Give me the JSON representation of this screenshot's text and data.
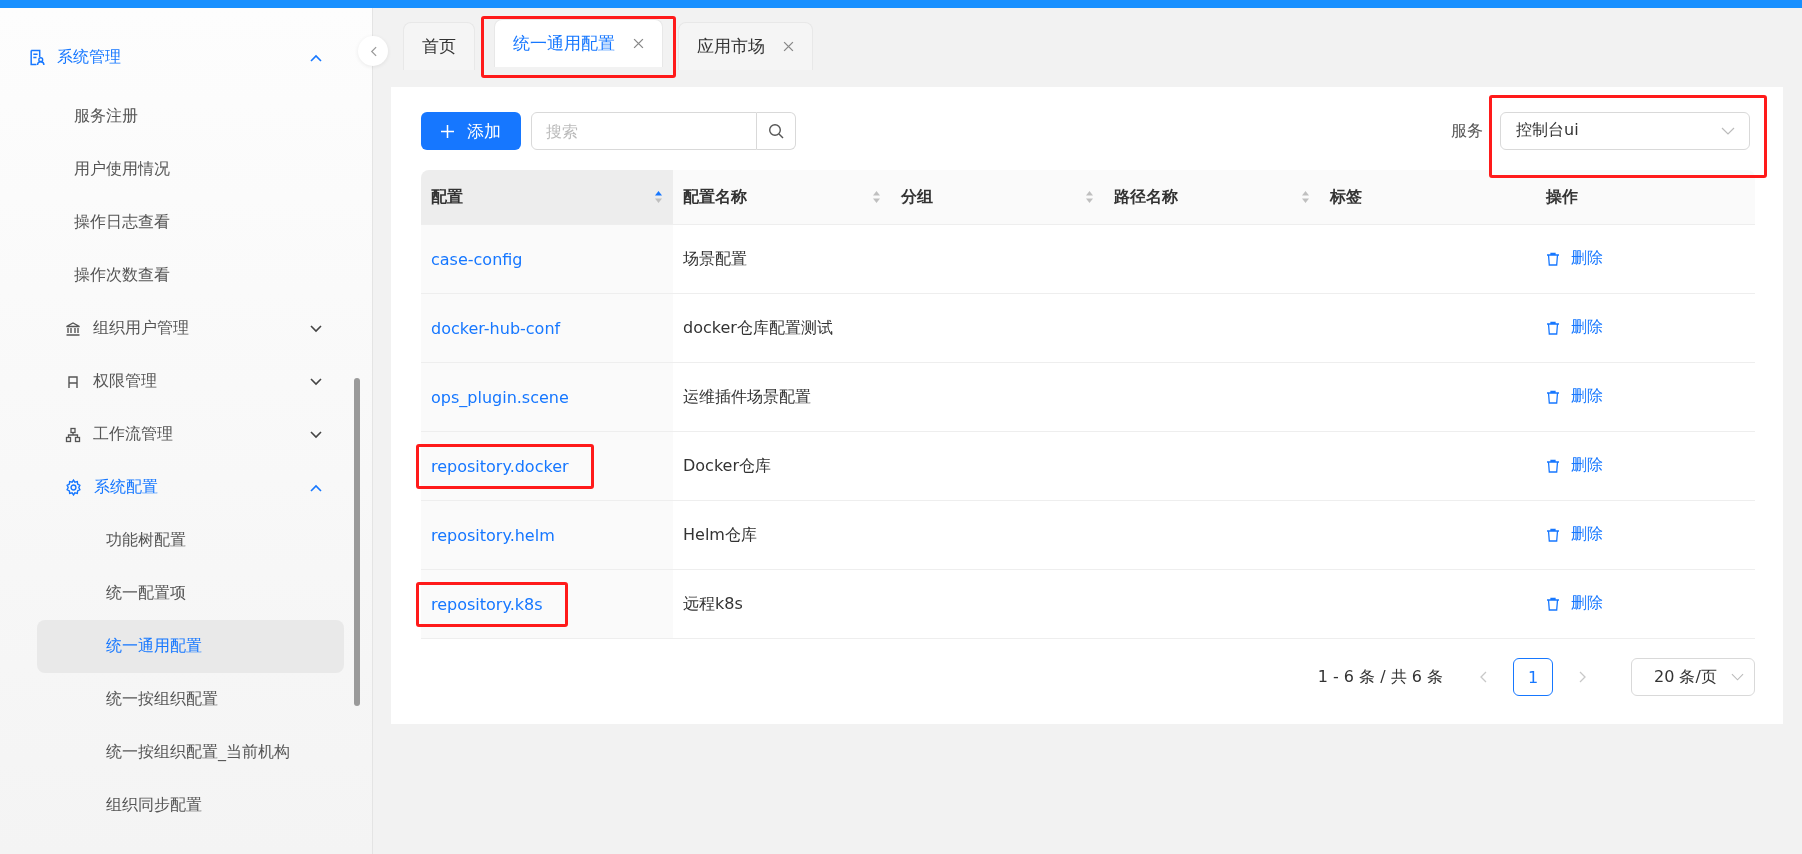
{
  "sidebar": {
    "items": [
      {
        "kind": "group",
        "label": "系统管理",
        "expanded": true,
        "active": true,
        "children": [
          {
            "kind": "leaf",
            "label": "服务注册",
            "selected": false
          },
          {
            "kind": "leaf",
            "label": "用户使用情况",
            "selected": false
          },
          {
            "kind": "leaf",
            "label": "操作日志查看",
            "selected": false
          },
          {
            "kind": "leaf",
            "label": "操作次数查看",
            "selected": false
          },
          {
            "kind": "group",
            "label": "组织用户管理",
            "expanded": false,
            "active": false
          },
          {
            "kind": "group",
            "label": "权限管理",
            "expanded": false,
            "active": false
          },
          {
            "kind": "group",
            "label": "工作流管理",
            "expanded": false,
            "active": false
          },
          {
            "kind": "group",
            "label": "系统配置",
            "expanded": true,
            "active": true,
            "children": [
              {
                "kind": "leaf",
                "label": "功能树配置",
                "selected": false
              },
              {
                "kind": "leaf",
                "label": "统一配置项",
                "selected": false
              },
              {
                "kind": "leaf",
                "label": "统一通用配置",
                "selected": true
              },
              {
                "kind": "leaf",
                "label": "统一按组织配置",
                "selected": false
              },
              {
                "kind": "leaf",
                "label": "统一按组织配置_当前机构",
                "selected": false
              },
              {
                "kind": "leaf",
                "label": "组织同步配置",
                "selected": false
              }
            ]
          }
        ]
      }
    ]
  },
  "tabs": [
    {
      "label": "首页",
      "selected": false,
      "closable": false,
      "highlighted": false
    },
    {
      "label": "统一通用配置",
      "selected": true,
      "closable": true,
      "highlighted": true
    },
    {
      "label": "应用市场",
      "selected": false,
      "closable": true,
      "highlighted": false
    }
  ],
  "toolbar": {
    "add_button": "添加",
    "search": {
      "placeholder": "搜索"
    },
    "service": {
      "label": "服务",
      "value": "控制台ui",
      "highlighted": true
    }
  },
  "table": {
    "columns": [
      {
        "label": "配置",
        "sortable": true,
        "sorted": true
      },
      {
        "label": "配置名称",
        "sortable": true,
        "sorted": false
      },
      {
        "label": "分组",
        "sortable": true,
        "sorted": false
      },
      {
        "label": "路径名称",
        "sortable": true,
        "sorted": false
      },
      {
        "label": "标签",
        "sortable": false
      },
      {
        "label": "操作",
        "sortable": false
      }
    ],
    "rows": [
      {
        "config": "case-config",
        "name": "场景配置",
        "action": "删除",
        "highlighted": false
      },
      {
        "config": "docker-hub-conf",
        "name": "docker仓库配置测试",
        "action": "删除",
        "highlighted": false
      },
      {
        "config": "ops_plugin.scene",
        "name": "运维插件场景配置",
        "action": "删除",
        "highlighted": false
      },
      {
        "config": "repository.docker",
        "name": "Docker仓库",
        "action": "删除",
        "highlighted": true
      },
      {
        "config": "repository.helm",
        "name": "Helm仓库",
        "action": "删除",
        "highlighted": false
      },
      {
        "config": "repository.k8s",
        "name": "远程k8s",
        "action": "删除",
        "highlighted": true
      }
    ]
  },
  "pagination": {
    "summary": "1 - 6 条 / 共 6 条",
    "prev_disabled": true,
    "next_disabled": true,
    "pages": [
      {
        "label": "1",
        "selected": true
      }
    ],
    "page_size": "20 条/页"
  }
}
